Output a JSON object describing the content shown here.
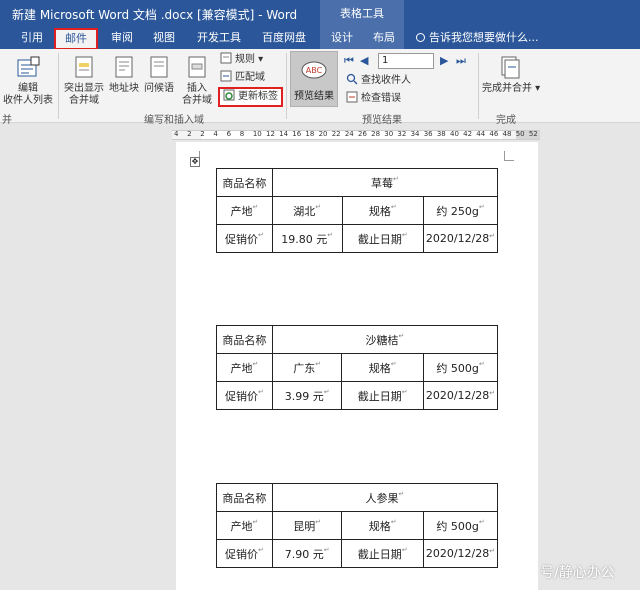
{
  "window": {
    "title": "新建 Microsoft Word 文档 .docx [兼容模式] - Word",
    "context_tools": "表格工具"
  },
  "tabs": [
    {
      "label": "引用"
    },
    {
      "label": "邮件"
    },
    {
      "label": "审阅"
    },
    {
      "label": "视图"
    },
    {
      "label": "开发工具"
    },
    {
      "label": "百度网盘"
    },
    {
      "label": "设计"
    },
    {
      "label": "布局"
    }
  ],
  "tellme": "告诉我您想要做什么...",
  "ribbon": {
    "edit_recipients": "编辑\n收件人列表",
    "highlight_fields": "突出显示\n合并域",
    "address_block": "地址块",
    "greeting_line": "问候语",
    "insert_field": "插入\n合并域",
    "rules": "规则",
    "match_fields": "匹配域",
    "update_labels": "更新标签",
    "preview_results": "预览结果",
    "record_number": "1",
    "find_recipient": "查找收件人",
    "check_errors": "检查错误",
    "finish_merge": "完成并合并",
    "group_start": "并",
    "group_write": "编写和插入域",
    "group_preview": "预览结果",
    "group_finish": "完成"
  },
  "ruler": {
    "numbers": [
      "4",
      "2",
      "2",
      "4",
      "6",
      "8",
      "10",
      "12",
      "14",
      "16",
      "18",
      "20",
      "22",
      "24",
      "26",
      "28",
      "30",
      "32",
      "34",
      "36",
      "38",
      "40",
      "42",
      "44",
      "46",
      "48",
      "50",
      "52"
    ]
  },
  "table_headers": {
    "name": "商品名称",
    "origin": "产地",
    "spec": "规格",
    "price": "促销价",
    "deadline": "截止日期"
  },
  "products": [
    {
      "name": "草莓",
      "origin": "湖北",
      "spec": "约 250g",
      "price": "19.80 元",
      "deadline": "2020/12/28"
    },
    {
      "name": "沙糖桔",
      "origin": "广东",
      "spec": "约 500g",
      "price": "3.99 元",
      "deadline": "2020/12/28"
    },
    {
      "name": "人参果",
      "origin": "昆明",
      "spec": "约 500g",
      "price": "7.90 元",
      "deadline": "2020/12/28"
    }
  ],
  "watermark": "号/静心办公",
  "colors": {
    "brand": "#2b579a",
    "context": "#4a6fab",
    "highlight": "#e02020"
  }
}
